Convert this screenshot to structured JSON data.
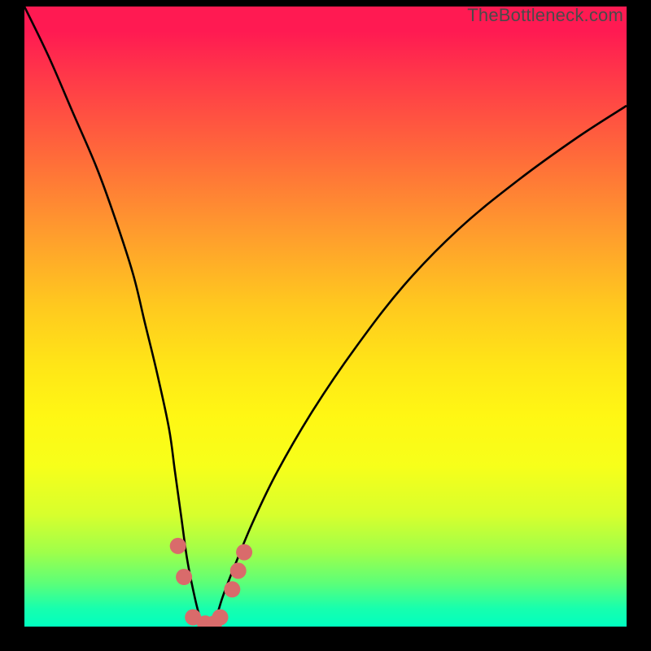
{
  "watermark": "TheBottleneck.com",
  "chart_data": {
    "type": "line",
    "title": "",
    "xlabel": "",
    "ylabel": "",
    "xlim": [
      0,
      100
    ],
    "ylim": [
      0,
      100
    ],
    "curve": {
      "name": "bottleneck-curve",
      "x": [
        0,
        4,
        8,
        12,
        15,
        18,
        20,
        22,
        24,
        25,
        26,
        27,
        28,
        29,
        30,
        31,
        32,
        33,
        35,
        38,
        42,
        48,
        55,
        63,
        72,
        82,
        92,
        100
      ],
      "y": [
        100,
        92,
        83,
        74,
        66,
        57,
        49,
        41,
        32,
        25,
        18,
        11,
        6,
        2,
        0,
        0,
        2,
        5,
        10,
        17,
        25,
        35,
        45,
        55,
        64,
        72,
        79,
        84
      ]
    },
    "markers": {
      "name": "highlight-points",
      "color": "#d96b6b",
      "points": [
        {
          "x": 25.5,
          "y": 13
        },
        {
          "x": 26.5,
          "y": 8
        },
        {
          "x": 28.0,
          "y": 1.5
        },
        {
          "x": 30.0,
          "y": 0.5
        },
        {
          "x": 31.5,
          "y": 0.5
        },
        {
          "x": 32.5,
          "y": 1.5
        },
        {
          "x": 34.5,
          "y": 6
        },
        {
          "x": 35.5,
          "y": 9
        },
        {
          "x": 36.5,
          "y": 12
        }
      ]
    },
    "gradient_stops": [
      {
        "pos": 0,
        "color": "#ff1a52"
      },
      {
        "pos": 50,
        "color": "#ffe617"
      },
      {
        "pos": 100,
        "color": "#00ffc0"
      }
    ]
  }
}
